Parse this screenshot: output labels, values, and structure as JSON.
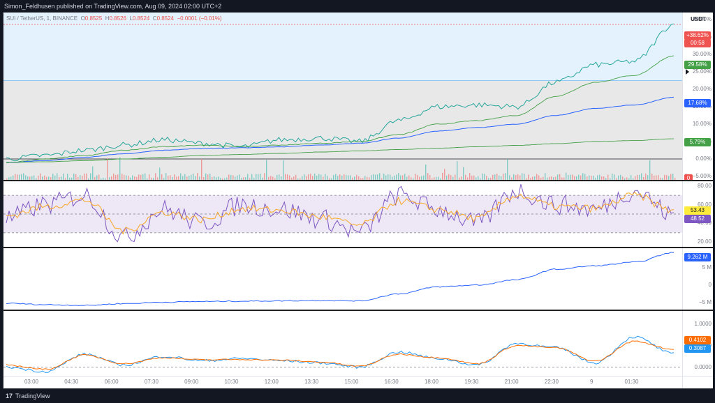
{
  "header": {
    "published": "Simon_Feldhusen published on TradingView.com, Aug 09, 2024 02:00 UTC+2"
  },
  "legend": {
    "symbol": "SUI / TetherUS, 1, BINANCE",
    "o_label": "O",
    "o_value": "0.8525",
    "h_label": "H",
    "h_value": "0.8526",
    "l_label": "L",
    "l_value": "0.8524",
    "c_label": "C",
    "c_value": "0.8524",
    "change": "−0.0001 (−0.01%)"
  },
  "price_axis": {
    "currency": "USDT",
    "ticks": [
      "40.00%",
      "35.00%",
      "30.00%",
      "25.00%",
      "20.00%",
      "15.00%",
      "10.00%",
      "5.00%",
      "0.00%",
      "−5.00%"
    ],
    "badges": {
      "last_pct": "+38.62%",
      "countdown": "00:58",
      "ma1": "29.58%",
      "ma2": "17.68%",
      "ma3": "5.79%",
      "volume": "0"
    },
    "colors": {
      "last": "#ef5350",
      "ma1": "#43a047",
      "ma2": "#2962ff",
      "ma3": "#43a047",
      "volume": "#ef5350"
    }
  },
  "rsi_axis": {
    "ticks": [
      "80.00",
      "60.00",
      "40.00",
      "20.00"
    ],
    "badges": {
      "rsi_ma": "53.43",
      "rsi": "48.52"
    },
    "colors": {
      "rsi_ma": "#ffeb3b",
      "rsi": "#7e57c2"
    }
  },
  "obv_axis": {
    "ticks": [
      "5 M",
      "0",
      "−5 M"
    ],
    "badges": {
      "obv": "9.262 M"
    },
    "colors": {
      "obv": "#2962ff"
    }
  },
  "macd_axis": {
    "ticks": [
      "1.0000",
      "0.5000",
      "0.0000"
    ],
    "badges": {
      "signal": "0.4102",
      "macd": "0.3087"
    },
    "colors": {
      "signal": "#ff6d00",
      "macd": "#2196f3"
    }
  },
  "time_axis": {
    "labels": [
      "03:00",
      "04:30",
      "06:00",
      "07:30",
      "09:00",
      "10:30",
      "12:00",
      "13:30",
      "15:00",
      "16:30",
      "18:00",
      "19:30",
      "21:00",
      "22:30",
      "9",
      "01:30"
    ]
  },
  "footer": {
    "brand_mark": "17",
    "brand": "TradingView"
  },
  "chart_data": [
    {
      "type": "line",
      "title": "",
      "x": [
        "02:00",
        "03:00",
        "04:30",
        "06:00",
        "07:30",
        "09:00",
        "10:30",
        "12:00",
        "13:30",
        "15:00",
        "16:30",
        "18:00",
        "19:30",
        "21:00",
        "22:30",
        "9",
        "01:30",
        "02:00"
      ],
      "series": [
        {
          "values": [
            0,
            1,
            2.5,
            4,
            5.5,
            4.5,
            3.5,
            5.5,
            6,
            5,
            11,
            15,
            15.5,
            15,
            22,
            27,
            28,
            38.6
          ]
        },
        {
          "values": [
            -1,
            0,
            1,
            2.5,
            3.5,
            4,
            3.5,
            4,
            4.5,
            5,
            7,
            10,
            11,
            12.5,
            18,
            22,
            24,
            29.6
          ]
        },
        {
          "values": [
            -1,
            -0.5,
            0.5,
            1.5,
            2.5,
            3,
            3.2,
            3.5,
            4,
            4.5,
            6,
            8,
            9,
            10,
            12.5,
            14.5,
            15.5,
            17.7
          ]
        },
        {
          "values": [
            -1,
            -0.8,
            -0.5,
            0,
            0.5,
            1,
            1.3,
            1.6,
            2,
            2.3,
            2.7,
            3.1,
            3.5,
            3.9,
            4.4,
            5,
            5.3,
            5.8
          ]
        }
      ],
      "xlabel": "",
      "ylabel": "",
      "ylim": [
        -6,
        42
      ],
      "bands": {
        "upper_start": 22.5,
        "upper_color": "#e3f2fd",
        "lower_color": "#e8e8e8"
      }
    },
    {
      "type": "line",
      "x": [
        "02:00",
        "03:00",
        "04:30",
        "06:00",
        "07:30",
        "09:00",
        "10:30",
        "12:00",
        "13:30",
        "15:00",
        "16:30",
        "18:00",
        "19:30",
        "21:00",
        "22:30",
        "9",
        "01:30",
        "02:00"
      ],
      "series": [
        {
          "values": [
            45,
            60,
            70,
            25,
            55,
            40,
            60,
            55,
            45,
            30,
            70,
            55,
            40,
            75,
            60,
            55,
            75,
            48.5
          ]
        },
        {
          "values": [
            48,
            58,
            65,
            32,
            52,
            44,
            56,
            54,
            47,
            38,
            64,
            55,
            45,
            70,
            58,
            56,
            70,
            53.4
          ]
        }
      ],
      "ylim": [
        15,
        85
      ],
      "levels": [
        70,
        50,
        30
      ]
    },
    {
      "type": "line",
      "x": [
        "02:00",
        "03:00",
        "04:30",
        "06:00",
        "07:30",
        "09:00",
        "10:30",
        "12:00",
        "13:30",
        "15:00",
        "16:30",
        "18:00",
        "19:30",
        "21:00",
        "22:30",
        "9",
        "01:30",
        "02:00"
      ],
      "series": [
        {
          "values": [
            -5.2,
            -5.6,
            -5.8,
            -5.3,
            -4.9,
            -4.7,
            -4.6,
            -4.5,
            -4.4,
            -4.5,
            -2.5,
            -0.5,
            0,
            1.5,
            4.5,
            5.5,
            6.5,
            9.26
          ]
        }
      ],
      "ylim": [
        -7,
        10.5
      ]
    },
    {
      "type": "line",
      "x": [
        "02:00",
        "03:00",
        "04:30",
        "06:00",
        "07:30",
        "09:00",
        "10:30",
        "12:00",
        "13:30",
        "15:00",
        "16:30",
        "18:00",
        "19:30",
        "21:00",
        "22:30",
        "9",
        "01:30",
        "02:00"
      ],
      "series": [
        {
          "values": [
            0,
            -0.1,
            0.3,
            0.05,
            0.25,
            0.15,
            0.2,
            0.15,
            0.1,
            0,
            0.35,
            0.2,
            0.05,
            0.55,
            0.45,
            0.1,
            0.7,
            0.31
          ]
        },
        {
          "values": [
            0.05,
            -0.05,
            0.28,
            0.08,
            0.22,
            0.17,
            0.18,
            0.16,
            0.12,
            0.02,
            0.3,
            0.22,
            0.08,
            0.5,
            0.45,
            0.14,
            0.6,
            0.41
          ]
        }
      ],
      "ylim": [
        -0.2,
        1.3
      ],
      "levels": [
        0
      ]
    }
  ]
}
